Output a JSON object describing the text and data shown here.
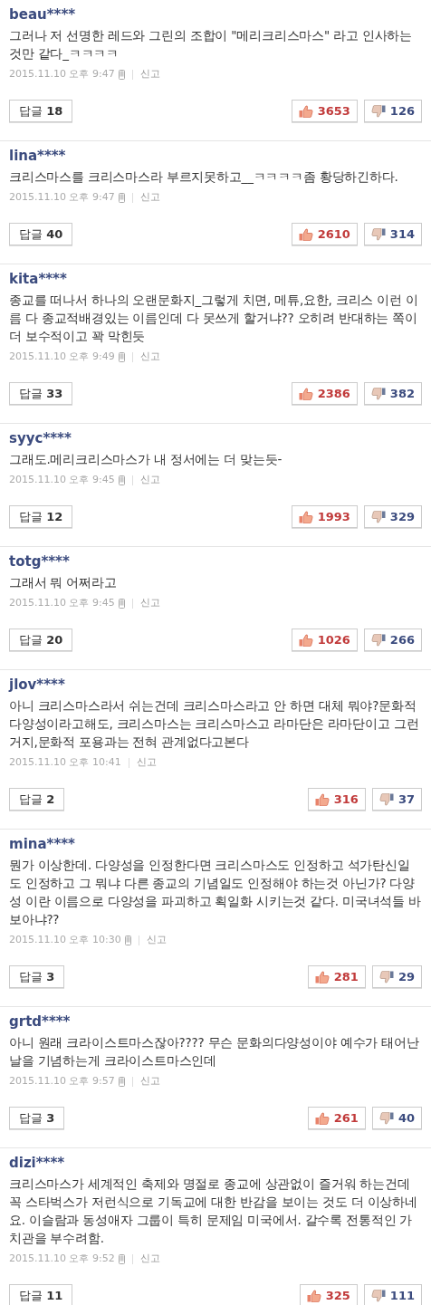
{
  "comments": [
    {
      "user": "beau****",
      "text": "그러나 저 선명한 레드와 그린의 조합이 \"메리크리스마스\" 라고 인사하는 것만 같다_ㅋㅋㅋㅋ",
      "date": "2015.11.10 오후 9:47",
      "mobile": true,
      "report": "신고",
      "reply_label": "답글",
      "replies": "18",
      "likes": "3653",
      "dislikes": "126"
    },
    {
      "user": "lina****",
      "text": "크리스마스를 크리스마스라 부르지못하고__ㅋㅋㅋㅋ좀 황당하긴하다.",
      "date": "2015.11.10 오후 9:47",
      "mobile": true,
      "report": "신고",
      "reply_label": "답글",
      "replies": "40",
      "likes": "2610",
      "dislikes": "314"
    },
    {
      "user": "kita****",
      "text": "종교를 떠나서 하나의 오랜문화지_그렇게 치면, 메튜,요한, 크리스 이런 이름 다 종교적배경있는 이름인데 다 못쓰게 할거냐?? 오히려 반대하는 쪽이 더 보수적이고 꽉 막힌듯",
      "date": "2015.11.10 오후 9:49",
      "mobile": true,
      "report": "신고",
      "reply_label": "답글",
      "replies": "33",
      "likes": "2386",
      "dislikes": "382"
    },
    {
      "user": "syyc****",
      "text": "그래도.메리크리스마스가 내 정서에는 더 맞는듯-",
      "date": "2015.11.10 오후 9:45",
      "mobile": true,
      "report": "신고",
      "reply_label": "답글",
      "replies": "12",
      "likes": "1993",
      "dislikes": "329"
    },
    {
      "user": "totg****",
      "text": "그래서 뭐 어쩌라고",
      "date": "2015.11.10 오후 9:45",
      "mobile": true,
      "report": "신고",
      "reply_label": "답글",
      "replies": "20",
      "likes": "1026",
      "dislikes": "266"
    },
    {
      "user": "jlov****",
      "text": "아니 크리스마스라서 쉬는건데 크리스마스라고 안 하면 대체 뭐야?문화적 다양성이라고해도, 크리스마스는 크리스마스고 라마단은 라마단이고 그런거지,문화적 포용과는 전혀 관계없다고본다",
      "date": "2015.11.10 오후 10:41",
      "mobile": false,
      "report": "신고",
      "reply_label": "답글",
      "replies": "2",
      "likes": "316",
      "dislikes": "37"
    },
    {
      "user": "mina****",
      "text": "뭔가 이상한데. 다양성을 인정한다면 크리스마스도 인정하고 석가탄신일도 인정하고 그 뭐냐 다른 종교의 기념일도 인정해야 하는것 아닌가? 다양성 이란 이름으로 다양성을 파괴하고 획일화 시키는것 같다. 미국녀석들 바보아냐??",
      "date": "2015.11.10 오후 10:30",
      "mobile": true,
      "report": "신고",
      "reply_label": "답글",
      "replies": "3",
      "likes": "281",
      "dislikes": "29"
    },
    {
      "user": "grtd****",
      "text": "아니 원래 크라이스트마스잖아???? 무슨 문화의다양성이야 예수가 태어난날을 기념하는게 크라이스트마스인데",
      "date": "2015.11.10 오후 9:57",
      "mobile": true,
      "report": "신고",
      "reply_label": "답글",
      "replies": "3",
      "likes": "261",
      "dislikes": "40"
    },
    {
      "user": "dizi****",
      "text": "크리스마스가 세계적인 축제와 명절로 종교에 상관없이 즐거워 하는건데 꼭 스타벅스가 저런식으로 기독교에 대한 반감을 보이는 것도 더 이상하네요. 이슬람과 동성애자 그룹이 특히 문제임 미국에서. 갈수록 전통적인 가치관을 부수려함.",
      "date": "2015.11.10 오후 9:52",
      "mobile": true,
      "report": "신고",
      "reply_label": "답글",
      "replies": "11",
      "likes": "325",
      "dislikes": "111"
    }
  ]
}
